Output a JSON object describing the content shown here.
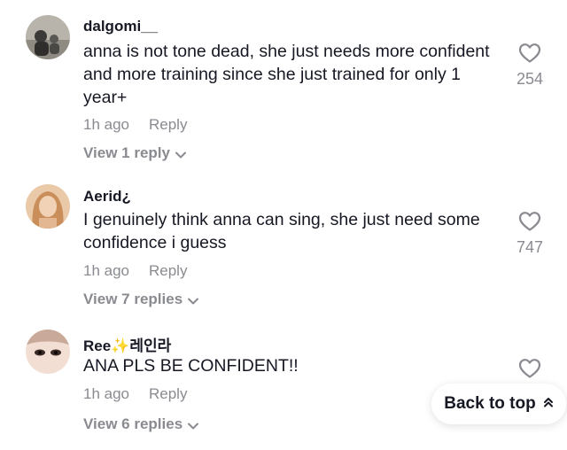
{
  "comments": [
    {
      "username": "dalgomi__",
      "text": "anna is not tone dead, she just needs more confident and more training since she just trained for only 1 year+",
      "time": "1h ago",
      "reply_label": "Reply",
      "view_replies": "View 1 reply",
      "likes": "254"
    },
    {
      "username": "Aerid¿",
      "text": "I genuinely think anna can sing, she just need some confidence i guess",
      "time": "1h ago",
      "reply_label": "Reply",
      "view_replies": "View 7 replies",
      "likes": "747"
    },
    {
      "username": "Ree✨레인라",
      "text": "ANA PLS BE CONFIDENT!!",
      "time": "1h ago",
      "reply_label": "Reply",
      "view_replies": "View 6 replies",
      "likes": ""
    }
  ],
  "back_to_top": "Back to top",
  "icons": {
    "like": "heart-outline-icon",
    "expand": "chevron-down-icon",
    "scroll_up": "double-chevron-up-icon"
  },
  "colors": {
    "primary_text": "#161823",
    "secondary_text": "#8a8b91"
  }
}
